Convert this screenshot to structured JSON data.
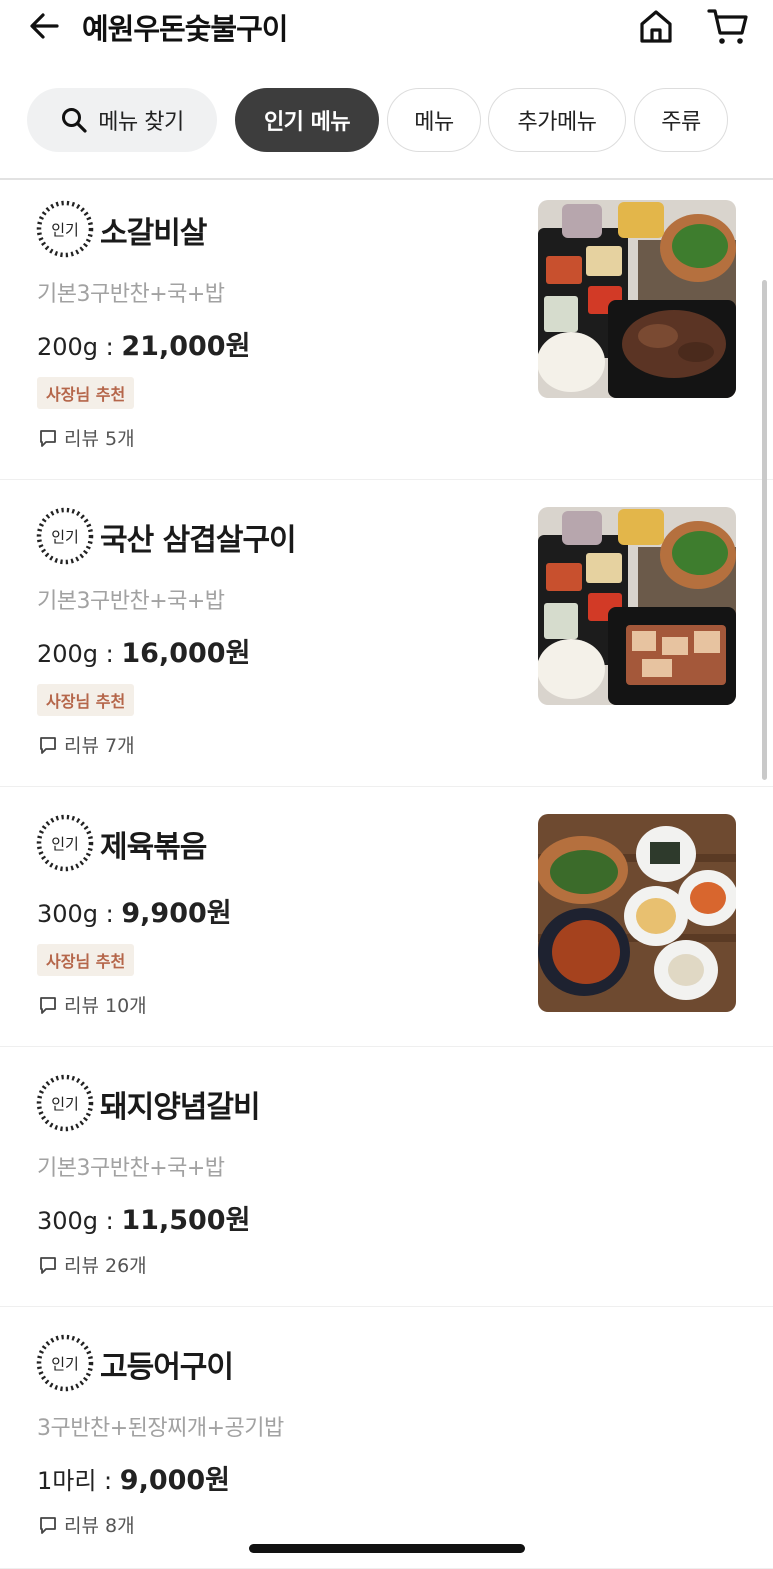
{
  "header": {
    "title": "예원우돈숯불구이",
    "back_icon": "arrow-left-icon",
    "home_icon": "home-icon",
    "cart_icon": "cart-icon"
  },
  "tabs": {
    "search_label": "메뉴 찾기",
    "items": [
      "인기 메뉴",
      "메뉴",
      "추가메뉴",
      "주류"
    ],
    "active_index": 0
  },
  "popular_badge_text": "인기",
  "menu_items": [
    {
      "name": "소갈비살",
      "desc": "기본3구반찬+국+밥",
      "weight": "200g : ",
      "price": "21,000원",
      "recommend": "사장님 추천",
      "review": "리뷰 5개",
      "has_image": true
    },
    {
      "name": "국산 삼겹살구이",
      "desc": "기본3구반찬+국+밥",
      "weight": "200g : ",
      "price": "16,000원",
      "recommend": "사장님 추천",
      "review": "리뷰 7개",
      "has_image": true
    },
    {
      "name": "제육볶음",
      "desc": "",
      "weight": "300g : ",
      "price": "9,900원",
      "recommend": "사장님 추천",
      "review": "리뷰 10개",
      "has_image": true
    },
    {
      "name": "돼지양념갈비",
      "desc": "기본3구반찬+국+밥",
      "weight": "300g : ",
      "price": "11,500원",
      "recommend": "",
      "review": "리뷰 26개",
      "has_image": false
    },
    {
      "name": "고등어구이",
      "desc": "3구반찬+된장찌개+공기밥",
      "weight": "1마리 : ",
      "price": "9,000원",
      "recommend": "",
      "review": "리뷰 8개",
      "has_image": false
    }
  ],
  "colors": {
    "active_tab_bg": "#3d3d3d",
    "recommend_bg": "#f4efe8",
    "recommend_text": "#b5664a",
    "desc_text": "#a2a2a2"
  }
}
